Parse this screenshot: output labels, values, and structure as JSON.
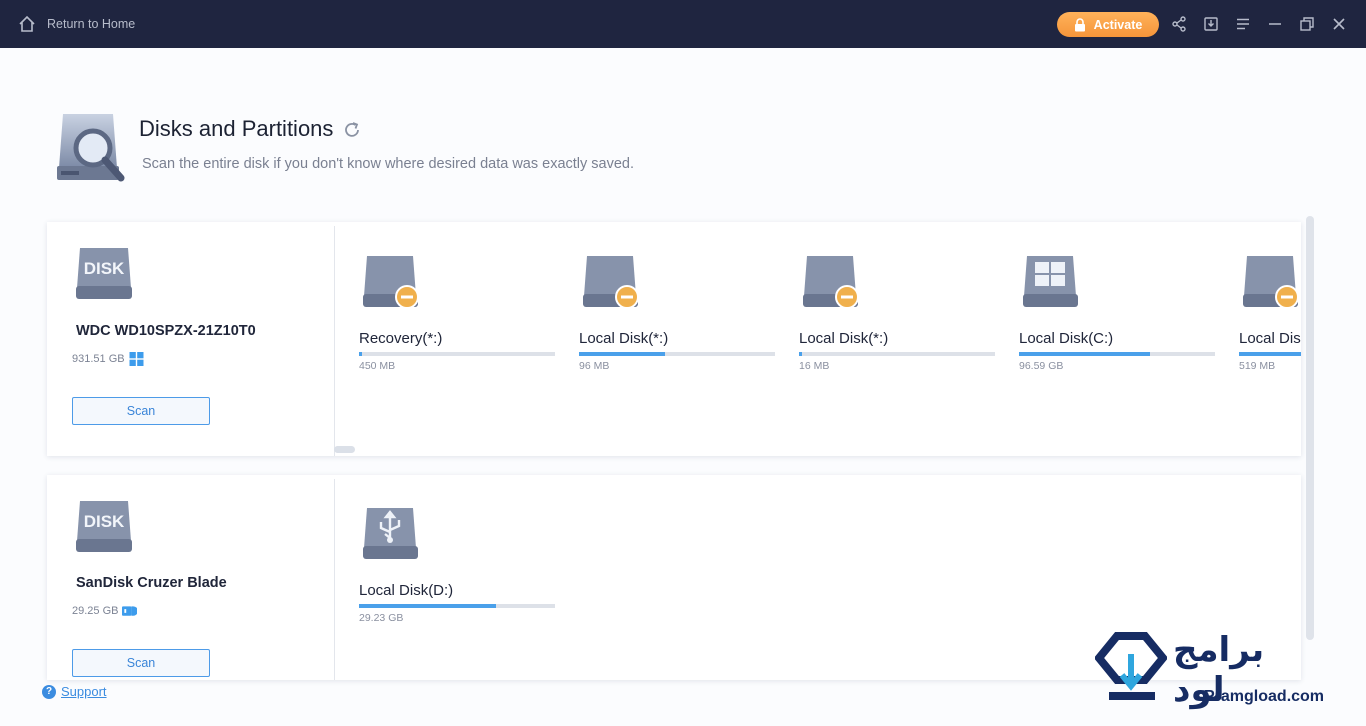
{
  "titlebar": {
    "home_label": "Return to Home",
    "activate_label": "Activate",
    "accent": "#f7a044",
    "icons": [
      "share-icon",
      "download-icon",
      "menu-icon",
      "minimize-icon",
      "restore-icon",
      "close-icon"
    ]
  },
  "header": {
    "title": "Disks and Partitions",
    "subtitle": "Scan the entire disk if you don't know where desired data was exactly saved."
  },
  "disks": [
    {
      "art_label": "DISK",
      "name": "WDC WD10SPZX-21Z10T0",
      "size": "931.51 GB",
      "os_icon": "windows-icon",
      "scan_label": "Scan",
      "partitions": [
        {
          "name": "Recovery(*:)",
          "size": "450 MB",
          "used_fraction": 0.01,
          "icon": "drive-minus-icon"
        },
        {
          "name": "Local Disk(*:)",
          "size": "96 MB",
          "used_fraction": 0.44,
          "icon": "drive-minus-icon"
        },
        {
          "name": "Local Disk(*:)",
          "size": "16 MB",
          "used_fraction": 0.01,
          "icon": "drive-minus-icon"
        },
        {
          "name": "Local Disk(C:)",
          "size": "96.59 GB",
          "used_fraction": 0.67,
          "icon": "windows-drive-icon"
        },
        {
          "name": "Local Disk(*:)",
          "size": "519 MB",
          "used_fraction": 0.5,
          "icon": "drive-minus-icon"
        }
      ]
    },
    {
      "art_label": "DISK",
      "name": "SanDisk Cruzer Blade",
      "size": "29.25 GB",
      "os_icon": "usb-badge-icon",
      "scan_label": "Scan",
      "partitions": [
        {
          "name": "Local Disk(D:)",
          "size": "29.23 GB",
          "used_fraction": 0.7,
          "icon": "usb-drive-icon"
        }
      ]
    }
  ],
  "footer": {
    "support_label": "Support"
  },
  "watermark": {
    "arabic": "برامج لود",
    "latin": "Pramgload.com"
  }
}
